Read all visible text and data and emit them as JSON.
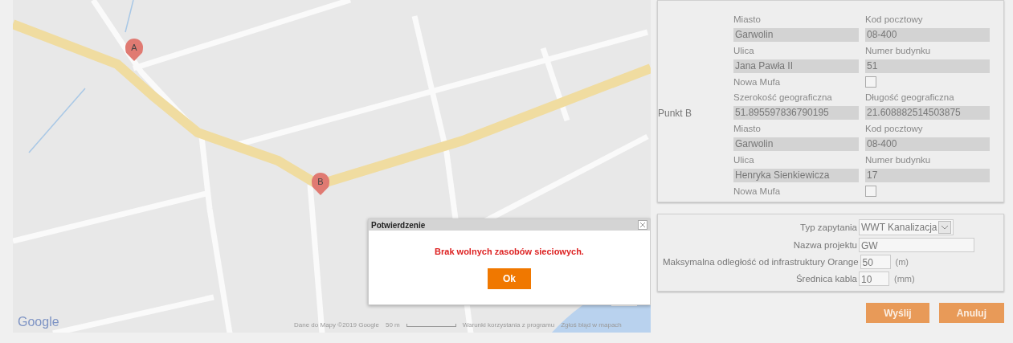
{
  "map": {
    "markers": [
      {
        "label": "A"
      },
      {
        "label": "B"
      }
    ],
    "logo": "Google",
    "attribution": [
      "Dane do Mapy ©2019 Google",
      "50 m",
      "Warunki korzystania z programu",
      "Zgłoś błąd w mapach"
    ]
  },
  "points": [
    {
      "rows": [
        {
          "kind": "labels",
          "texts": [
            "Miasto",
            "Kod pocztowy"
          ]
        },
        {
          "kind": "fields",
          "values": [
            "Garwolin",
            "08-400"
          ]
        },
        {
          "kind": "labels",
          "texts": [
            "Ulica",
            "Numer budynku"
          ]
        },
        {
          "kind": "fields",
          "values": [
            "Jana Pawła II",
            "51"
          ]
        },
        {
          "kind": "checkbox",
          "label": "Nowa Mufa",
          "checked": false
        }
      ]
    },
    {
      "label": "Punkt B",
      "rows": [
        {
          "kind": "labels",
          "texts": [
            "Szerokość geograficzna",
            "Długość geograficzna"
          ]
        },
        {
          "kind": "fields",
          "values": [
            "51.895597836790195",
            "21.608882514503875"
          ]
        },
        {
          "kind": "labels",
          "texts": [
            "Miasto",
            "Kod pocztowy"
          ]
        },
        {
          "kind": "fields",
          "values": [
            "Garwolin",
            "08-400"
          ]
        },
        {
          "kind": "labels",
          "texts": [
            "Ulica",
            "Numer budynku"
          ]
        },
        {
          "kind": "fields",
          "values": [
            "Henryka Sienkiewicza",
            "17"
          ]
        },
        {
          "kind": "checkbox",
          "label": "Nowa Mufa",
          "checked": false
        }
      ]
    }
  ],
  "request": [
    {
      "kind": "select",
      "label": "Typ zapytania",
      "value": "WWT Kanalizacja"
    },
    {
      "kind": "wide",
      "label": "Nazwa projektu",
      "value": "GW"
    },
    {
      "kind": "unit",
      "label": "Maksymalna odległość od infrastruktury Orange",
      "value": "50",
      "unit": "(m)"
    },
    {
      "kind": "unit",
      "label": "Średnica kabla",
      "value": "10",
      "unit": "(mm)"
    }
  ],
  "buttons": [
    "Wyślij",
    "Anuluj"
  ],
  "dialog": {
    "title": "Potwierdzenie",
    "message": "Brak wolnych zasobów sieciowych.",
    "button": "Ok"
  }
}
